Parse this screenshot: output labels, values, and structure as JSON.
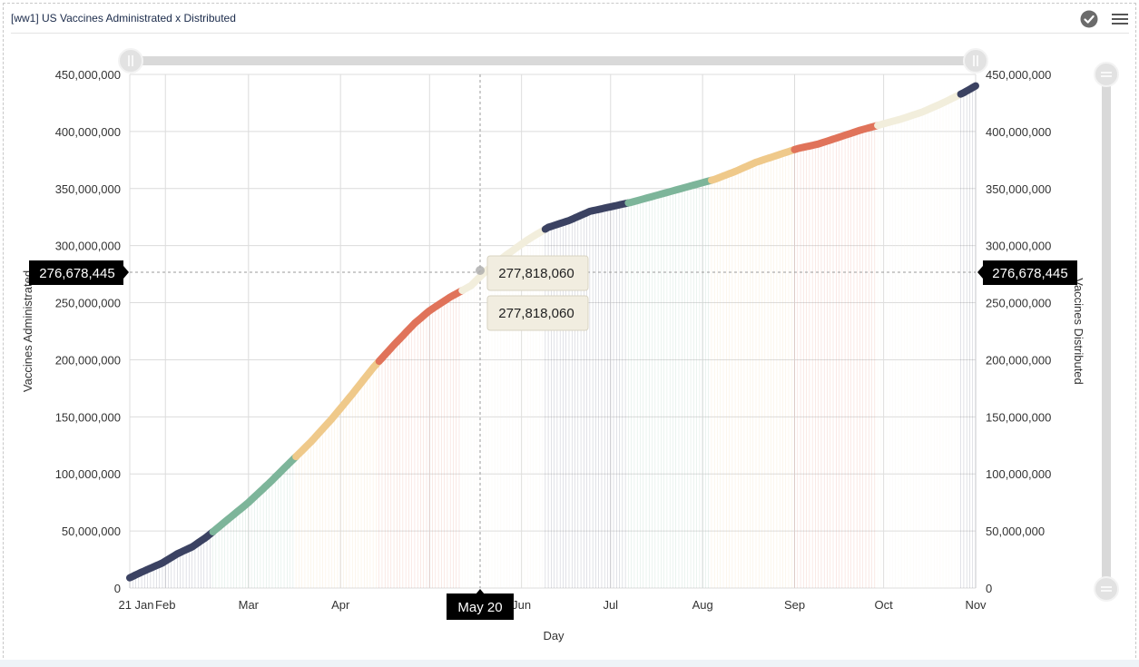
{
  "panel": {
    "title": "[ww1] US Vaccines Administrated x Distributed"
  },
  "icons": {
    "check": "check-circle-icon",
    "menu": "hamburger-menu-icon"
  },
  "colors": {
    "navy": "#3b4262",
    "green": "#7db59a",
    "tan": "#efc98a",
    "orange": "#e0735a",
    "cream": "#f2eedc",
    "grid": "#dcdcdc",
    "marker_bg": "#000000",
    "tooltip_bg": "#f1ede0",
    "scrollbar": "#d9d9d9"
  },
  "chart_data": {
    "type": "line",
    "xlabel": "Day",
    "ylabel_left": "Vaccines Administrated",
    "ylabel_right": "Vaccines Distributed",
    "x_ticks": [
      "21 Jan",
      "Feb",
      "Mar",
      "Apr",
      "Jun",
      "Jul",
      "Aug",
      "Sep",
      "Oct",
      "Nov"
    ],
    "y_ticks": [
      "0",
      "50,000,000",
      "100,000,000",
      "150,000,000",
      "200,000,000",
      "250,000,000",
      "300,000,000",
      "350,000,000",
      "400,000,000",
      "450,000,000"
    ],
    "ylim": [
      0,
      450000000
    ],
    "xlim": [
      "2021-01-20",
      "2021-11-01"
    ],
    "grid": true,
    "crosshair": {
      "x_label": "May 20",
      "y_label_left": "276,678,445",
      "y_label_right": "276,678,445",
      "tooltip_values": [
        "277,818,060",
        "277,818,060"
      ]
    },
    "series": [
      {
        "values": [
          [
            "2021-01-20",
            9000000
          ],
          [
            "2021-01-24",
            14000000
          ],
          [
            "2021-01-31",
            22000000
          ],
          [
            "2021-02-05",
            30000000
          ],
          [
            "2021-02-10",
            36000000
          ],
          [
            "2021-02-15",
            45000000
          ],
          [
            "2021-02-22",
            60000000
          ],
          [
            "2021-03-01",
            75000000
          ],
          [
            "2021-03-08",
            92000000
          ],
          [
            "2021-03-15",
            110000000
          ],
          [
            "2021-03-22",
            128000000
          ],
          [
            "2021-03-29",
            148000000
          ],
          [
            "2021-04-05",
            170000000
          ],
          [
            "2021-04-12",
            193000000
          ],
          [
            "2021-04-19",
            213000000
          ],
          [
            "2021-04-26",
            232000000
          ],
          [
            "2021-05-01",
            243000000
          ],
          [
            "2021-05-08",
            255000000
          ],
          [
            "2021-05-15",
            265000000
          ],
          [
            "2021-05-20",
            277818060
          ],
          [
            "2021-05-27",
            292000000
          ],
          [
            "2021-06-03",
            305000000
          ],
          [
            "2021-06-10",
            316000000
          ],
          [
            "2021-06-17",
            322000000
          ],
          [
            "2021-06-24",
            330000000
          ],
          [
            "2021-07-01",
            334000000
          ],
          [
            "2021-07-08",
            338000000
          ],
          [
            "2021-07-15",
            343000000
          ],
          [
            "2021-07-22",
            348000000
          ],
          [
            "2021-07-29",
            353000000
          ],
          [
            "2021-08-05",
            358000000
          ],
          [
            "2021-08-12",
            365000000
          ],
          [
            "2021-08-19",
            373000000
          ],
          [
            "2021-08-26",
            379000000
          ],
          [
            "2021-09-02",
            385000000
          ],
          [
            "2021-09-09",
            389000000
          ],
          [
            "2021-09-16",
            395000000
          ],
          [
            "2021-09-23",
            401000000
          ],
          [
            "2021-09-30",
            406000000
          ],
          [
            "2021-10-07",
            411000000
          ],
          [
            "2021-10-14",
            417000000
          ],
          [
            "2021-10-21",
            425000000
          ],
          [
            "2021-10-28",
            434000000
          ],
          [
            "2021-11-01",
            440000000
          ]
        ]
      }
    ]
  }
}
